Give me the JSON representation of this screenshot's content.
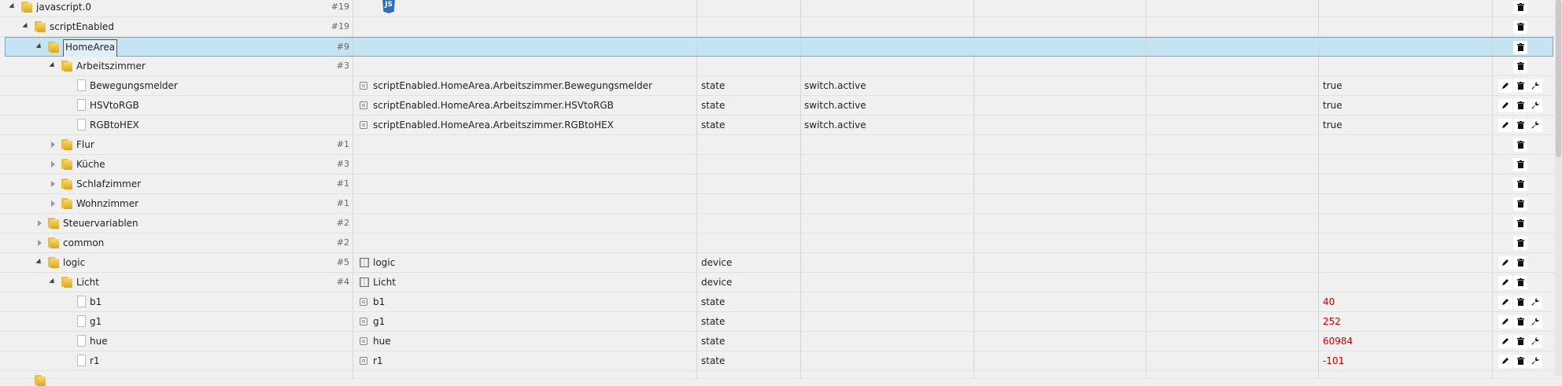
{
  "rows": [
    {
      "level": 0,
      "arrow": "open",
      "icon": "folder",
      "name": "javascript.0",
      "count": "#19",
      "js": "JS",
      "buttons": [
        "delete"
      ]
    },
    {
      "level": 1,
      "arrow": "open",
      "icon": "folder",
      "name": "scriptEnabled",
      "count": "#19",
      "buttons": [
        "delete"
      ]
    },
    {
      "level": 2,
      "arrow": "open",
      "icon": "folder",
      "name": "HomeArea",
      "count": "#9",
      "selected": true,
      "buttons": [
        "delete"
      ]
    },
    {
      "level": 3,
      "arrow": "open",
      "icon": "folder",
      "name": "Arbeitszimmer",
      "count": "#3",
      "buttons": [
        "delete"
      ]
    },
    {
      "level": 4,
      "icon": "file",
      "name": "Bewegungsmelder",
      "objIcon": "state",
      "objName": "scriptEnabled.HomeArea.Arbeitszimmer.Bewegungsmelder",
      "type": "state",
      "role": "switch.active",
      "value": "true",
      "buttons": [
        "edit",
        "delete",
        "config"
      ]
    },
    {
      "level": 4,
      "icon": "file",
      "name": "HSVtoRGB",
      "objIcon": "state",
      "objName": "scriptEnabled.HomeArea.Arbeitszimmer.HSVtoRGB",
      "type": "state",
      "role": "switch.active",
      "value": "true",
      "buttons": [
        "edit",
        "delete",
        "config"
      ]
    },
    {
      "level": 4,
      "icon": "file",
      "name": "RGBtoHEX",
      "objIcon": "state",
      "objName": "scriptEnabled.HomeArea.Arbeitszimmer.RGBtoHEX",
      "type": "state",
      "role": "switch.active",
      "value": "true",
      "buttons": [
        "edit",
        "delete",
        "config"
      ]
    },
    {
      "level": 3,
      "arrow": "closed",
      "icon": "folder",
      "name": "Flur",
      "count": "#1",
      "buttons": [
        "delete"
      ]
    },
    {
      "level": 3,
      "arrow": "closed",
      "icon": "folder",
      "name": "Küche",
      "count": "#3",
      "buttons": [
        "delete"
      ]
    },
    {
      "level": 3,
      "arrow": "closed",
      "icon": "folder",
      "name": "Schlafzimmer",
      "count": "#1",
      "buttons": [
        "delete"
      ]
    },
    {
      "level": 3,
      "arrow": "closed",
      "icon": "folder",
      "name": "Wohnzimmer",
      "count": "#1",
      "buttons": [
        "delete"
      ]
    },
    {
      "level": 2,
      "arrow": "closed",
      "icon": "folder",
      "name": "Steuervariablen",
      "count": "#2",
      "buttons": [
        "delete"
      ]
    },
    {
      "level": 2,
      "arrow": "closed",
      "icon": "folder",
      "name": "common",
      "count": "#2",
      "buttons": [
        "delete"
      ]
    },
    {
      "level": 2,
      "arrow": "open",
      "icon": "folder",
      "name": "logic",
      "count": "#5",
      "objIcon": "device",
      "objName": "logic",
      "type": "device",
      "buttons": [
        "edit",
        "delete"
      ]
    },
    {
      "level": 3,
      "arrow": "open",
      "icon": "folder",
      "name": "Licht",
      "count": "#4",
      "objIcon": "device",
      "objName": "Licht",
      "type": "device",
      "buttons": [
        "edit",
        "delete"
      ]
    },
    {
      "level": 4,
      "icon": "file",
      "name": "b1",
      "objIcon": "state",
      "objName": "b1",
      "type": "state",
      "value": "40",
      "valueColor": "red",
      "buttons": [
        "edit",
        "delete",
        "config"
      ]
    },
    {
      "level": 4,
      "icon": "file",
      "name": "g1",
      "objIcon": "state",
      "objName": "g1",
      "type": "state",
      "value": "252",
      "valueColor": "red",
      "buttons": [
        "edit",
        "delete",
        "config"
      ]
    },
    {
      "level": 4,
      "icon": "file",
      "name": "hue",
      "objIcon": "state",
      "objName": "hue",
      "type": "state",
      "value": "60984",
      "valueColor": "red",
      "buttons": [
        "edit",
        "delete",
        "config"
      ]
    },
    {
      "level": 4,
      "icon": "file",
      "name": "r1",
      "objIcon": "state",
      "objName": "r1",
      "type": "state",
      "value": "-101",
      "valueColor": "red",
      "buttons": [
        "edit",
        "delete",
        "config"
      ]
    },
    {
      "level": 1,
      "icon": "folder",
      "name": "",
      "partial": true,
      "buttons": []
    }
  ],
  "colors": {
    "selectedRow": "#c4e3f3",
    "valueRed": "#cc0000",
    "folder": "#e7c04c"
  }
}
